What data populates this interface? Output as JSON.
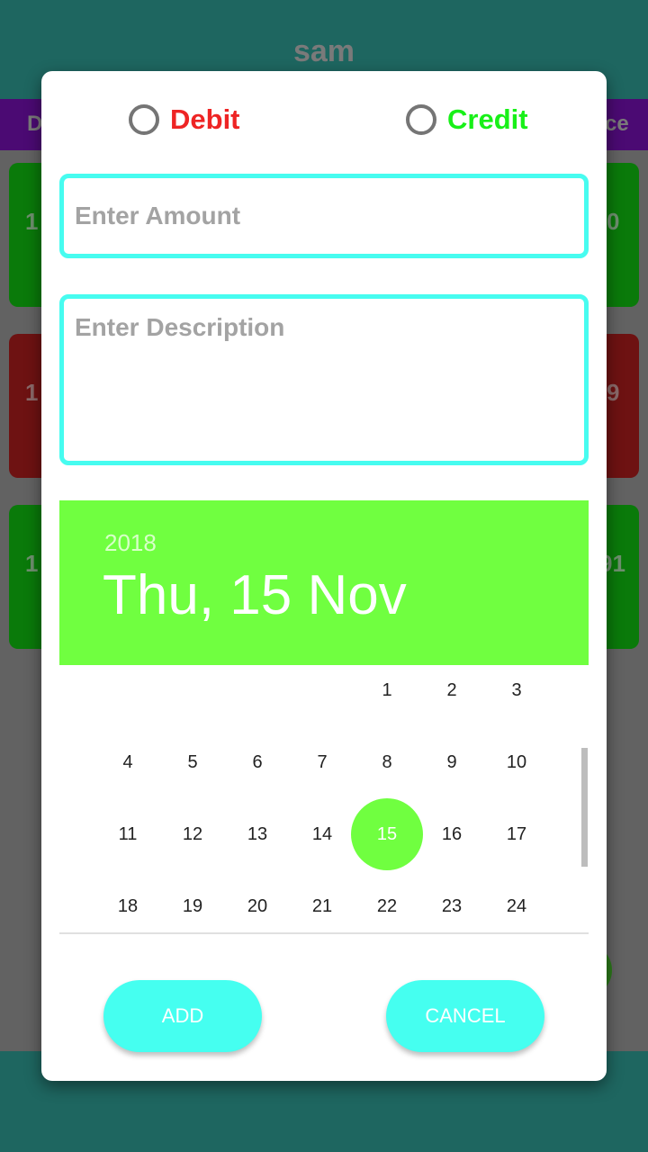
{
  "app": {
    "title": "sam",
    "header_columns": [
      "D",
      "ce"
    ],
    "cards": [
      {
        "left_value": "1",
        "right_value": "0",
        "type": "credit"
      },
      {
        "left_value": "1",
        "right_value": "9",
        "type": "debit"
      },
      {
        "left_value": "1",
        "right_value": "91",
        "type": "credit"
      }
    ]
  },
  "dialog": {
    "radio_options": [
      {
        "label": "Debit",
        "color": "#ee2424",
        "selected": false
      },
      {
        "label": "Credit",
        "color": "#18f018",
        "selected": false
      }
    ],
    "amount": {
      "value": "",
      "placeholder": "Enter Amount"
    },
    "description": {
      "value": "",
      "placeholder": "Enter Description"
    },
    "date_picker": {
      "year": "2018",
      "selected_date_label": "Thu, 15 Nov",
      "selected_day": 15,
      "accent_color": "#70ff40",
      "weeks": [
        [
          "",
          "",
          "",
          "",
          "1",
          "2",
          "3"
        ],
        [
          "4",
          "5",
          "6",
          "7",
          "8",
          "9",
          "10"
        ],
        [
          "11",
          "12",
          "13",
          "14",
          "15",
          "16",
          "17"
        ],
        [
          "18",
          "19",
          "20",
          "21",
          "22",
          "23",
          "24"
        ]
      ]
    },
    "buttons": {
      "add": "ADD",
      "cancel": "CANCEL"
    }
  }
}
